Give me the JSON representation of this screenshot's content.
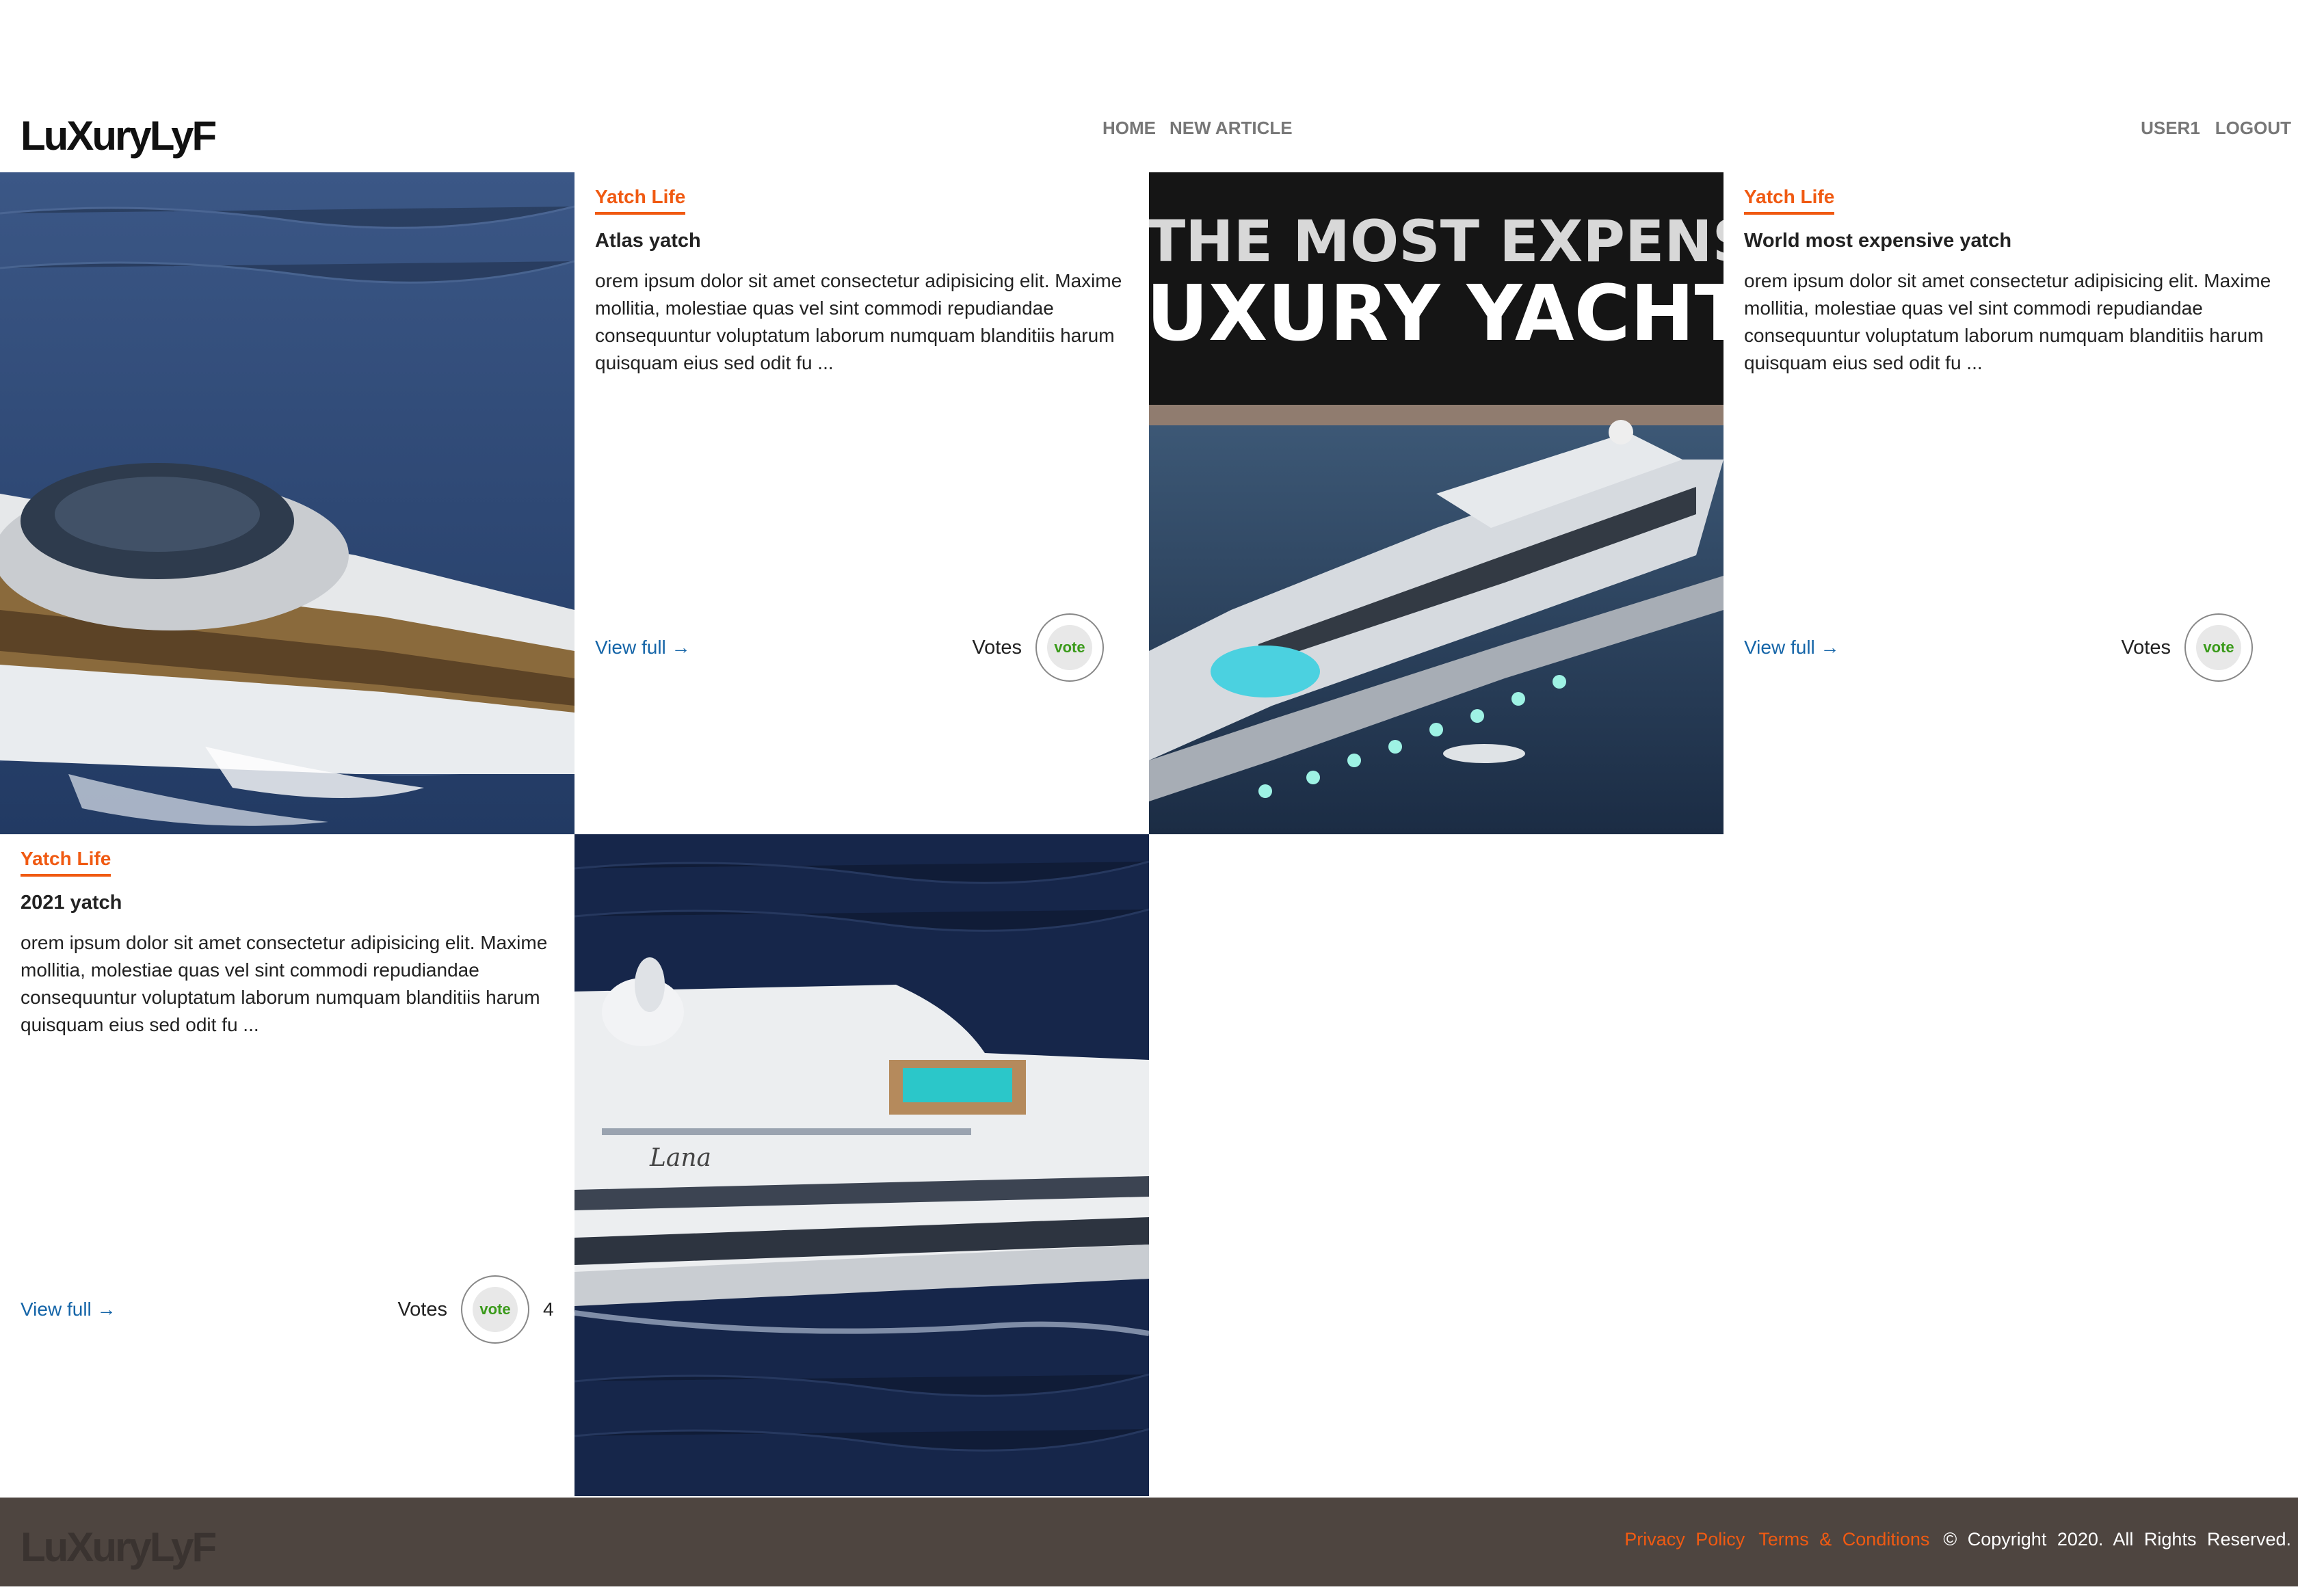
{
  "header": {
    "logo": "LuXuryLyF",
    "nav_center": [
      "HOME",
      "NEW ARTICLE"
    ],
    "nav_right": [
      "USER1",
      "LOGOUT"
    ]
  },
  "articles": [
    {
      "category": "Yatch Life",
      "title": "Atlas yatch",
      "excerpt": "orem ipsum dolor sit amet consectetur adipisicing elit. Maxime mollitia, molestiae quas vel sint commodi repudiandae consequuntur voluptatum laborum numquam blanditiis harum quisquam eius sed odit fu ...",
      "view_full": "View full →",
      "votes_label": "Votes",
      "vote_button": "vote",
      "vote_count": ""
    },
    {
      "category": "Yatch Life",
      "title": "World most expensive yatch",
      "excerpt": "orem ipsum dolor sit amet consectetur adipisicing elit. Maxime mollitia, molestiae quas vel sint commodi repudiandae consequuntur voluptatum laborum numquam blanditiis harum quisquam eius sed odit fu ...",
      "view_full": "View full →",
      "votes_label": "Votes",
      "vote_button": "vote",
      "vote_count": "",
      "image_text_line1": "THE MOST EXPENSIVE",
      "image_text_line2": "UXURY YACHT"
    },
    {
      "category": "Yatch Life",
      "title": "2021 yatch",
      "excerpt": "orem ipsum dolor sit amet consectetur adipisicing elit. Maxime mollitia, molestiae quas vel sint commodi repudiandae consequuntur voluptatum laborum numquam blanditiis harum quisquam eius sed odit fu ...",
      "view_full": "View full →",
      "votes_label": "Votes",
      "vote_button": "vote",
      "vote_count": "4",
      "image_text": "Lana"
    }
  ],
  "footer": {
    "logo": "LuXuryLyF",
    "privacy": "Privacy Policy",
    "terms": "Terms & Conditions",
    "copyright": "© Copyright 2020. All Rights Reserved."
  },
  "colors": {
    "accent": "#f05a12",
    "link": "#1565a8",
    "footer_bg": "#4e4540",
    "vote_text": "#3a9a1a"
  }
}
